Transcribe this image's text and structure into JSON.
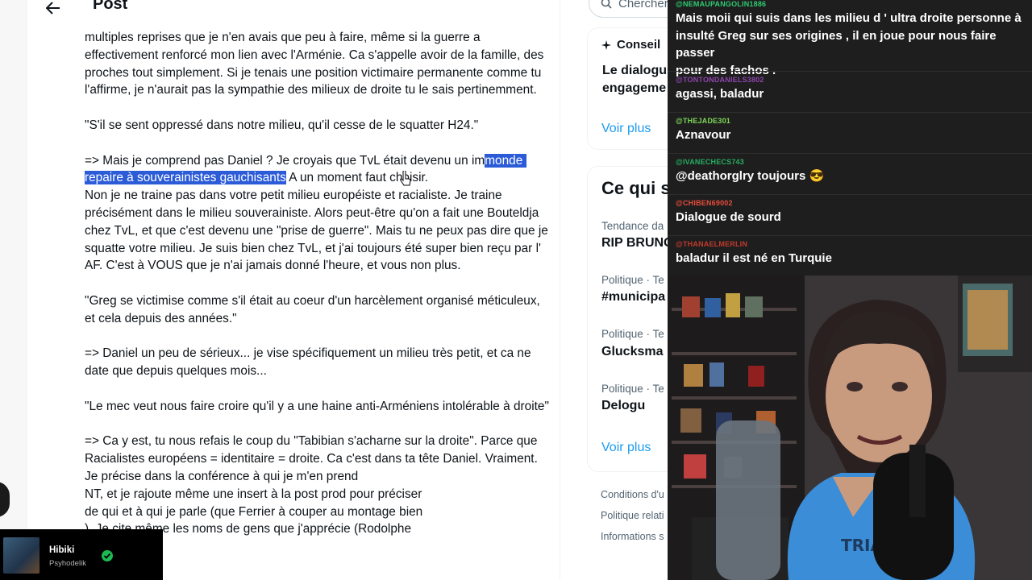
{
  "post": {
    "title": "Post",
    "paragraphs": [
      "multiples reprises que je n'en avais que peu à faire, même si la guerre a effectivement renforcé mon lien avec l'Arménie. Ca s'appelle avoir de la famille, des proches tout simplement. Si je tenais une position victimaire permanente comme tu l'affirme, je n'aurait pas la sympathie des milieux de droite tu le sais pertinemment.",
      "\"S'il se sent oppressé dans notre milieu, qu'il cesse de le squatter H24.\"",
      "=> Mais je comprend pas Daniel ? Je croyais que TvL était devenu un im",
      "Non je ne traine pas dans votre petit milieu européiste et racialiste. Je traine précisément dans le milieu souverainiste. Alors peut-être qu'on a fait une Bouteldja chez TvL, et que c'est devenu une \"prise de guerre\". Mais tu ne peux pas dire que je squatte votre milieu. Je suis bien chez TvL, et j'ai toujours été super bien reçu par l' AF. C'est à VOUS que je n'ai jamais donné l'heure, et vous non plus.",
      "\"Greg se victimise comme s'il était au coeur d'un harcèlement organisé méticuleux, et cela depuis des années.\"",
      "=> Daniel un peu de sérieux... je vise spécifiquement un milieu très petit, et ca ne date que depuis quelques mois...",
      "\"Le mec veut nous faire croire qu'il y a une haine anti-Arméniens intolérable à droite\"",
      "=> Ca y est, tu nous refais le coup du \"Tabibian s'acharne sur la droite\". Parce que Racialistes européens = identitaire = droite. Ca c'est dans ta tête Daniel. Vraiment. Je précise dans la conférence à qui je m'en prend",
      "NT, et je rajoute même une insert à la post prod pour préciser",
      "de qui et à qui je parle (que Ferrier à couper au montage bien",
      "). Je cite même les noms de gens que j'apprécie (Rodolphe"
    ],
    "highlighted": "monde repaire à souverainistes gauchisants",
    "after_highlight": "A un moment faut choisir."
  },
  "sidebar": {
    "search_placeholder": "Chercher",
    "card1": {
      "title": "Conseil",
      "subtitle_l1": "Le dialogu",
      "subtitle_l2": "engageme",
      "more": "Voir plus"
    },
    "card2": {
      "title": "Ce qui s",
      "trends": [
        {
          "meta": "Tendance da",
          "name": "RIP BRUNO"
        },
        {
          "meta": "Politique · Te",
          "name": "#municipa"
        },
        {
          "meta": "Politique · Te",
          "name": "Glucksma"
        },
        {
          "meta": "Politique · Te",
          "name": "Delogu"
        }
      ],
      "more": "Voir plus"
    },
    "footer": [
      "Conditions d'u",
      "Politique relati",
      "Informations s"
    ]
  },
  "chat": {
    "messages": [
      {
        "user": "@NEMAUPANGOLIN1886",
        "color": "#2ecc71",
        "lines": [
          "Mais moii qui suis dans les milieu d ' ultra droite personne à",
          "insulté Greg sur ses origines , il en joue pour nous faire passer",
          "pour des fachos ."
        ]
      },
      {
        "user": "@TONTONDANIELS3802",
        "color": "#8e44ad",
        "lines": [
          "agassi, baladur"
        ]
      },
      {
        "user": "@THEJADE301",
        "color": "#7ed957",
        "lines": [
          "Aznavour"
        ]
      },
      {
        "user": "@IVANECHECS743",
        "color": "#27ae60",
        "lines": [
          "@deathorglry toujours 😎"
        ]
      },
      {
        "user": "@CHIBEN69002",
        "color": "#e74c3c",
        "lines": [
          "Dialogue de sourd"
        ]
      },
      {
        "user": "@THANAELMERLIN",
        "color": "#c0392b",
        "lines": [
          "baladur il est né en Turquie"
        ]
      }
    ]
  },
  "now_playing": {
    "title": "Hibiki",
    "artist": "Psyhodelik"
  },
  "colors": {
    "highlight": "#2b5bd7",
    "link": "#1d9bf0",
    "chat_bg": "#1e1e1e"
  }
}
